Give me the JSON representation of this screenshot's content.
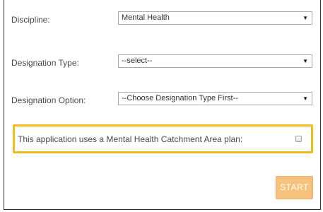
{
  "form": {
    "discipline": {
      "label": "Discipline:",
      "selected": "Mental Health"
    },
    "designation_type": {
      "label": "Designation Type:",
      "selected": "--select--"
    },
    "designation_option": {
      "label": "Designation Option:",
      "selected": "--Choose Designation Type First--"
    },
    "catchment": {
      "text": "This application uses a Mental Health Catchment Area plan:",
      "checked": false
    },
    "start_label": "START",
    "dropdown_caret": "▼"
  },
  "colors": {
    "highlight_border": "#f5bb1c",
    "start_button": "#f7c27e",
    "frame_border": "#2e2e2e"
  }
}
